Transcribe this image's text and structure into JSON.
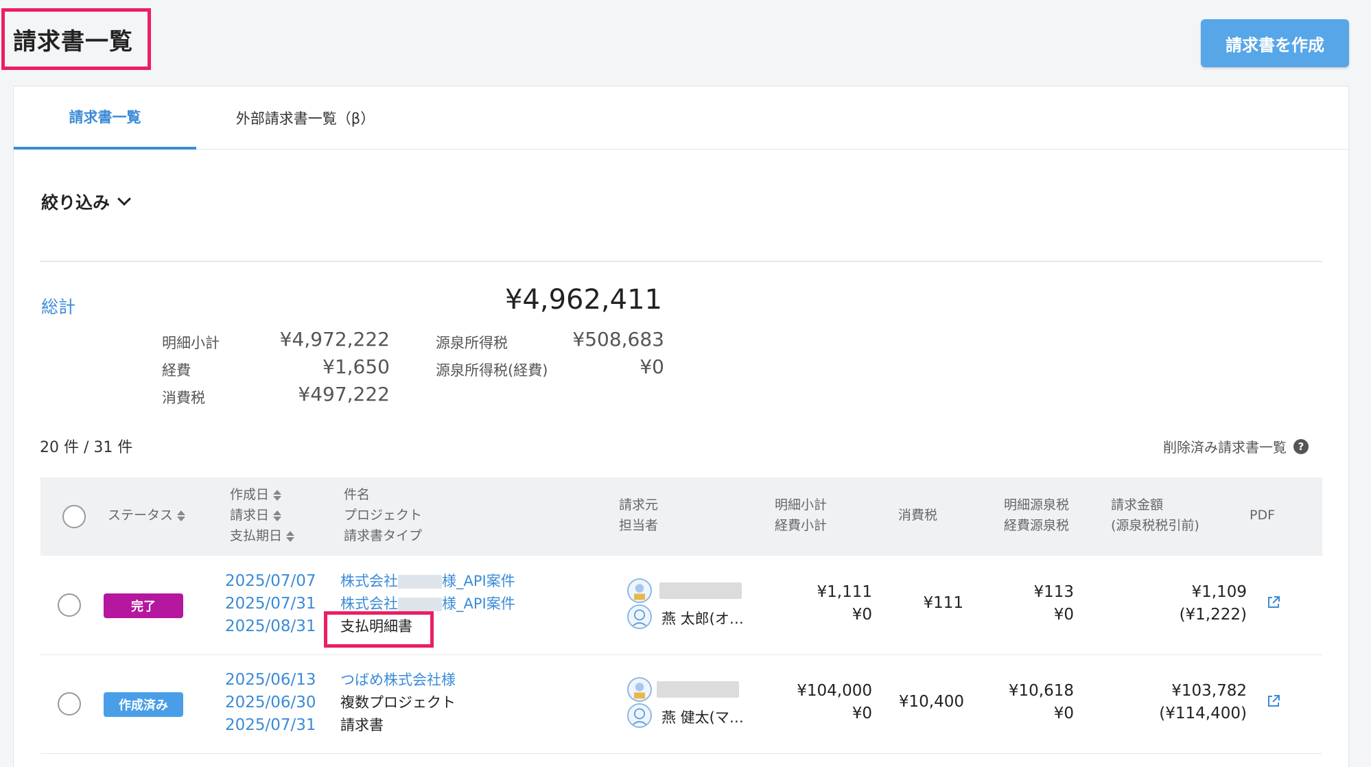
{
  "header": {
    "title": "請求書一覧",
    "create_button": "請求書を作成"
  },
  "tabs": [
    {
      "label": "請求書一覧",
      "active": true
    },
    {
      "label": "外部請求書一覧（β）",
      "active": false
    }
  ],
  "filter": {
    "label": "絞り込み"
  },
  "summary": {
    "total_label": "総計",
    "total_value": "¥4,962,411",
    "items": [
      {
        "label": "明細小計",
        "value": "¥4,972,222"
      },
      {
        "label": "経費",
        "value": "¥1,650"
      },
      {
        "label": "消費税",
        "value": "¥497,222"
      },
      {
        "label": "源泉所得税",
        "value": "¥508,683"
      },
      {
        "label": "源泉所得税(経費)",
        "value": "¥0"
      }
    ]
  },
  "list": {
    "count": "20 件 / 31 件",
    "deleted_link": "削除済み請求書一覧"
  },
  "table": {
    "headers": {
      "status": "ステータス",
      "created": "作成日",
      "invoice_date": "請求日",
      "due_date": "支払期日",
      "subject": "件名",
      "project": "プロジェクト",
      "type": "請求書タイプ",
      "issuer": "請求元",
      "assignee": "担当者",
      "subtotal": "明細小計",
      "expense_subtotal": "経費小計",
      "tax": "消費税",
      "withholding": "明細源泉税",
      "expense_withholding": "経費源泉税",
      "amount": "請求金額",
      "amount_note": "(源泉税税引前)",
      "pdf": "PDF"
    },
    "rows": [
      {
        "status": "完了",
        "status_color": "#b5179e",
        "created": "2025/07/07",
        "invoice_date": "2025/07/31",
        "due_date": "2025/08/31",
        "subject_prefix": "株式会社",
        "subject_suffix": "様_API案件",
        "project_prefix": "株式会社",
        "project_suffix": "様_API案件",
        "type": "支払明細書",
        "assignee": "燕 太郎(オ…",
        "subtotal": "¥1,111",
        "expense_subtotal": "¥0",
        "tax": "¥111",
        "withholding": "¥113",
        "expense_withholding": "¥0",
        "amount": "¥1,109",
        "amount_before": "(¥1,222)"
      },
      {
        "status": "作成済み",
        "status_color": "#4a9ee8",
        "created": "2025/06/13",
        "invoice_date": "2025/06/30",
        "due_date": "2025/07/31",
        "subject": "つばめ株式会社様",
        "project": "複数プロジェクト",
        "type": "請求書",
        "assignee": "燕 健太(マ…",
        "subtotal": "¥104,000",
        "expense_subtotal": "¥0",
        "tax": "¥10,400",
        "withholding": "¥10,618",
        "expense_withholding": "¥0",
        "amount": "¥103,782",
        "amount_before": "(¥114,400)"
      }
    ]
  }
}
